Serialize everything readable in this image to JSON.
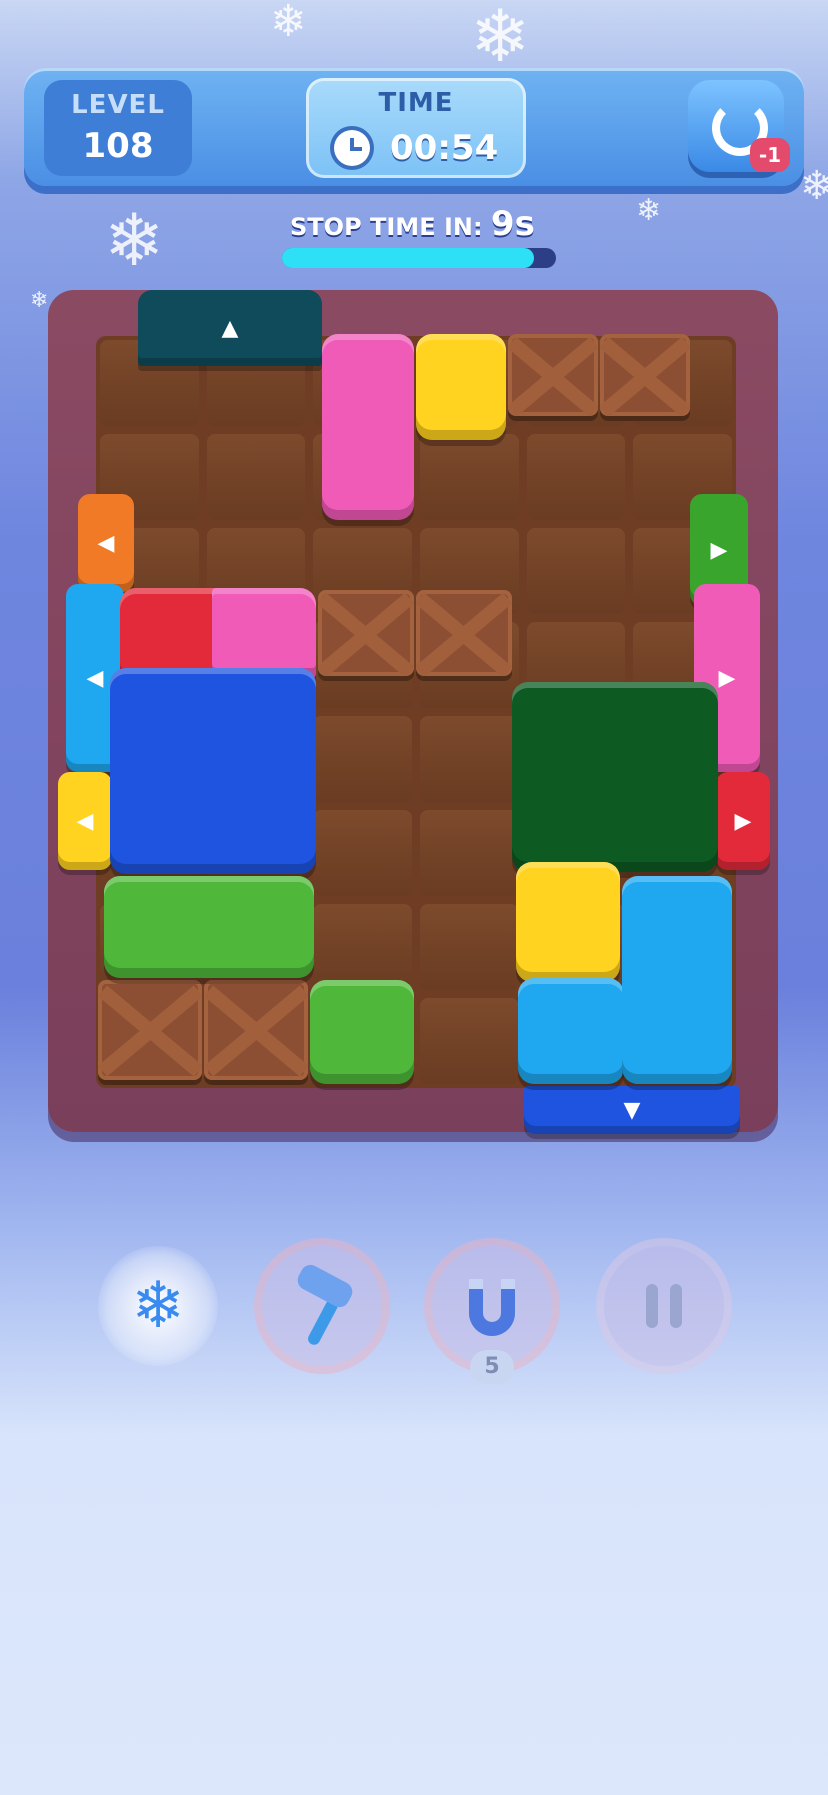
{
  "hud": {
    "level_title": "LEVEL",
    "level_value": "108",
    "time_title": "TIME",
    "time_value": "00:54",
    "restart_badge": "-1"
  },
  "stop_timer": {
    "label": "STOP TIME IN:",
    "value": "9s",
    "progress_fraction": 0.92
  },
  "colors": {
    "teal": "#0f4b5b",
    "pink": "#f05bb8",
    "yellow": "#ffd31f",
    "red": "#e22a3a",
    "blue": "#1e54e0",
    "dark_green": "#0d5a22",
    "green": "#4fb83a",
    "cyan": "#1fa8ef",
    "orange": "#f07a25",
    "gate_green": "#3aa52d"
  },
  "exits": [
    {
      "color": "teal",
      "arrow": "▲"
    },
    {
      "color": "orange",
      "arrow": "◀"
    },
    {
      "color": "cyan",
      "arrow": "◀"
    },
    {
      "color": "yellow",
      "arrow": "◀"
    },
    {
      "color": "gate_green",
      "arrow": "▶"
    },
    {
      "color": "pink",
      "arrow": "▶"
    },
    {
      "color": "red",
      "arrow": "▶"
    },
    {
      "color": "blue",
      "arrow": "▼"
    }
  ],
  "powerups": [
    {
      "icon": "snowflake-icon",
      "badge": ""
    },
    {
      "icon": "hammer-icon",
      "badge": ""
    },
    {
      "icon": "magnet-icon",
      "badge": "5"
    },
    {
      "icon": "pause-icon",
      "badge": ""
    }
  ]
}
